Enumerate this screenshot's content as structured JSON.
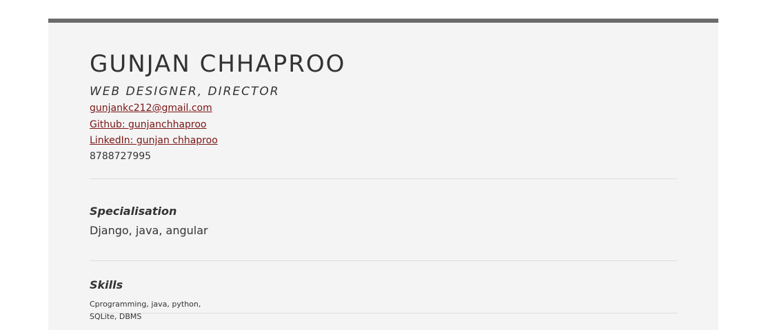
{
  "header": {
    "name": "GUNJAN CHHAPROO",
    "title": "WEB DESIGNER, DIRECTOR"
  },
  "contact": {
    "email": "gunjankc212@gmail.com",
    "github": "Github: gunjanchhaproo",
    "linkedin": "LinkedIn: gunjan chhaproo",
    "phone": "8788727995"
  },
  "sections": {
    "specialisation": {
      "heading": "Specialisation",
      "value": "Django, java, angular"
    },
    "skills": {
      "heading": "Skills",
      "value": "Cprogramming, java, python, SQLite, DBMS"
    }
  },
  "colors": {
    "accent_link": "#7a1515",
    "top_bar": "#6b6b6b",
    "sheet_bg": "#f4f4f4"
  }
}
